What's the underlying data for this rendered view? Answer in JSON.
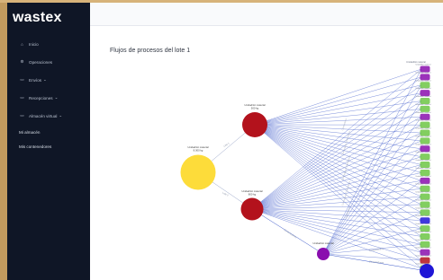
{
  "app": {
    "brand": "wastex"
  },
  "sidebar": {
    "items": [
      {
        "label": "Inicio",
        "icon": "home-icon",
        "expandable": false
      },
      {
        "label": "Operaciones",
        "icon": "operations-icon",
        "expandable": false
      },
      {
        "label": "Envíos",
        "icon": "box-icon",
        "expandable": true
      },
      {
        "label": "Recepciones",
        "icon": "box-icon",
        "expandable": true
      },
      {
        "label": "Almacén virtual",
        "icon": "box-icon",
        "expandable": true
      }
    ],
    "sub_items": [
      {
        "label": "Mi almacén"
      },
      {
        "label": "Mis contenedores"
      }
    ]
  },
  "main": {
    "title": "Flujos de procesos del lote 1"
  },
  "colors": {
    "sidebar_bg": "#0f1626",
    "yellow_node": "#fddc3a",
    "red_node": "#b3121c",
    "purple_node": "#8a0fae",
    "blue_node": "#1f16d6",
    "edge": "#3b58c9",
    "green_node": "#6cc644"
  },
  "graph": {
    "root": {
      "label": "Unidad/lot material",
      "sub": "8.000 kg"
    },
    "red_top": {
      "label": "Unidad/lot material",
      "sub": "500 kg"
    },
    "red_bottom": {
      "label": "Unidad/lot material",
      "sub": "800 kg"
    },
    "purple_mid": {
      "label": "Unidad/lot material"
    },
    "column_header": "Unidad/lot material",
    "edge_label_left": "Lote 1",
    "edge_label_mid": "Lote 2",
    "edge_label_bottom": "Contenedores",
    "edge_label_right": "Contenedores",
    "edge_label_right2": "Contenedores"
  }
}
